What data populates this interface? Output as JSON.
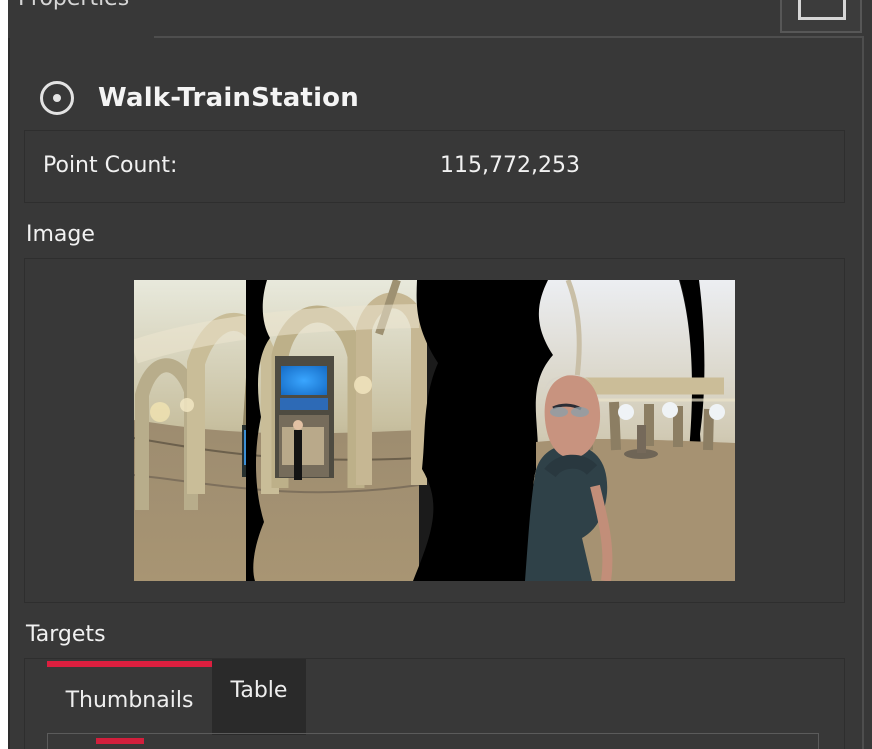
{
  "panel": {
    "title": "Properties",
    "window_button_icon": "window-restore-icon"
  },
  "scan": {
    "icon": "target-icon",
    "name": "Walk-TrainStation",
    "point_count_label": "Point Count:",
    "point_count_value": "115,772,253"
  },
  "image_section": {
    "label": "Image",
    "thumbnail": "panoramic-train-station-image"
  },
  "targets_section": {
    "label": "Targets",
    "tabs": [
      {
        "label": "Thumbnails",
        "active": true
      },
      {
        "label": "Table",
        "active": false
      }
    ]
  },
  "colors": {
    "panel_background": "#383838",
    "accent": "#dc1f3f",
    "text": "#f1f1f1",
    "border": "#2e2e2e"
  }
}
